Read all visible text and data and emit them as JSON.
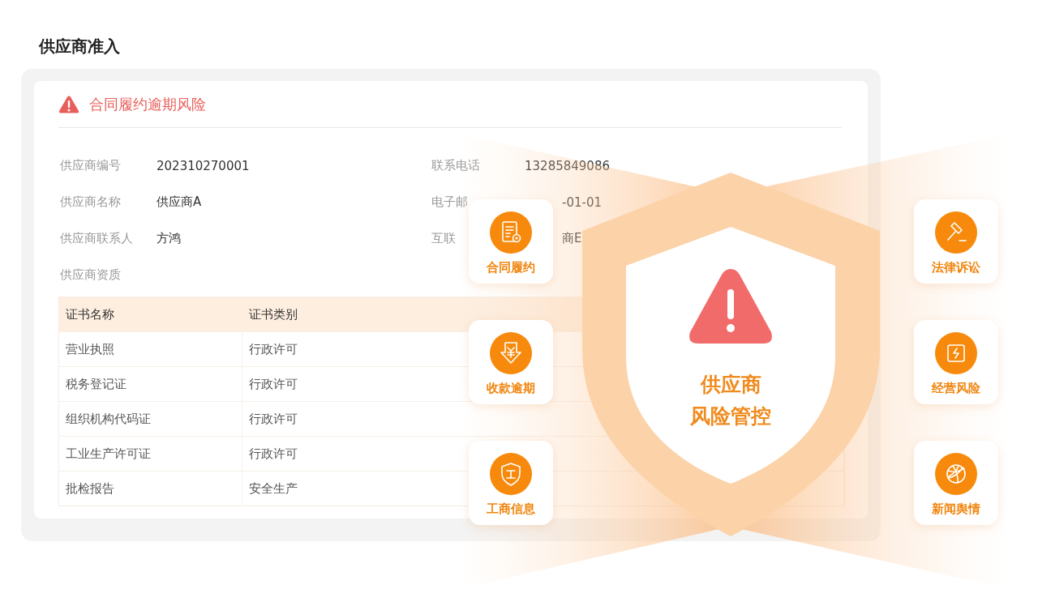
{
  "page_title": "供应商准入",
  "alert": {
    "title": "合同履约逾期风险"
  },
  "left_fields": [
    {
      "label": "供应商编号",
      "value": "202310270001"
    },
    {
      "label": "供应商名称",
      "value": "供应商A"
    },
    {
      "label": "供应商联系人",
      "value": "方鸿"
    },
    {
      "label": "供应商资质"
    }
  ],
  "right_fields": [
    {
      "label": "联系电话",
      "value": "13285849086"
    },
    {
      "label": "电子邮",
      "value": "-01-01"
    },
    {
      "label": "互联",
      "value": "商E"
    }
  ],
  "table": {
    "columns": [
      "证书名称",
      "证书类别"
    ],
    "rows": [
      [
        "营业执照",
        "行政许可"
      ],
      [
        "税务登记证",
        "行政许可"
      ],
      [
        "组织机构代码证",
        "行政许可"
      ],
      [
        "工业生产许可证",
        "行政许可"
      ],
      [
        "批检报告",
        "安全生产"
      ]
    ]
  },
  "risk_panel": {
    "title_lines": [
      "供应商",
      "风险管控"
    ],
    "left_categories": [
      {
        "label": "合同履约",
        "kind": "contract"
      },
      {
        "label": "收款逾期",
        "kind": "payment"
      },
      {
        "label": "工商信息",
        "kind": "business"
      }
    ],
    "right_categories": [
      {
        "label": "法律诉讼",
        "kind": "legal"
      },
      {
        "label": "经营风险",
        "kind": "operation"
      },
      {
        "label": "新闻舆情",
        "kind": "news"
      }
    ]
  }
}
